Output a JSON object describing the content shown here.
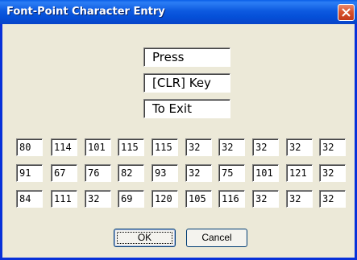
{
  "window": {
    "title": "Font-Point Character Entry"
  },
  "prompt": [
    "Press",
    "[CLR] Key",
    "To Exit"
  ],
  "grid": [
    [
      "80",
      "114",
      "101",
      "115",
      "115",
      "32",
      "32",
      "32",
      "32",
      "32"
    ],
    [
      "91",
      "67",
      "76",
      "82",
      "93",
      "32",
      "75",
      "101",
      "121",
      "32"
    ],
    [
      "84",
      "111",
      "32",
      "69",
      "120",
      "105",
      "116",
      "32",
      "32",
      "32"
    ]
  ],
  "buttons": {
    "ok": "OK",
    "cancel": "Cancel"
  },
  "icons": {
    "close": "close-icon"
  },
  "colors": {
    "titlebar": "#0A5FE8",
    "dialog_face": "#ECE9D8",
    "close_button": "#D8532E"
  }
}
